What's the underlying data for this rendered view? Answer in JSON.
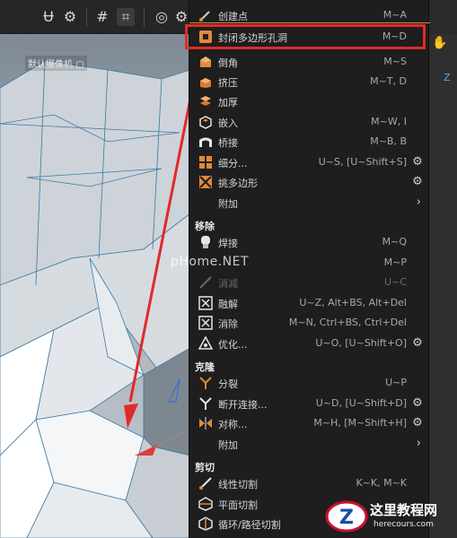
{
  "viewport": {
    "camera_label": "默认摄像机",
    "camera_icon": "camera-icon"
  },
  "watermark": {
    "text": "pHome.NET"
  },
  "logo": {
    "main": "这里教程网",
    "sub": "herecours.com"
  },
  "right_strip": {
    "axis_text": "Z"
  },
  "colors": {
    "highlight": "#e02a2a",
    "menu_bg": "#1e1e1e",
    "accent_orange": "#e08a3c"
  },
  "menu": {
    "items": [
      {
        "label": "创建点",
        "shortcut": "M~A",
        "icon": "create-point-icon"
      },
      {
        "label": "封闭多边形孔洞",
        "shortcut": "M~D",
        "icon": "close-polygon-hole-icon"
      },
      {
        "label": "倒角",
        "shortcut": "M~S",
        "icon": "bevel-icon"
      },
      {
        "label": "挤压",
        "shortcut": "M~T, D",
        "icon": "extrude-icon"
      },
      {
        "label": "加厚",
        "shortcut": "",
        "icon": "thicken-icon"
      },
      {
        "label": "嵌入",
        "shortcut": "M~W, I",
        "icon": "inset-icon"
      },
      {
        "label": "桥接",
        "shortcut": "M~B, B",
        "icon": "bridge-icon"
      },
      {
        "label": "细分...",
        "shortcut": "U~S, [U~Shift+S]",
        "icon": "subdivide-icon"
      },
      {
        "label": "挑多边形",
        "shortcut": "",
        "icon": "pick-polygon-icon"
      },
      {
        "label": "附加",
        "shortcut": "",
        "icon": ""
      }
    ],
    "section_remove": "移除",
    "remove_items": [
      {
        "label": "焊接",
        "shortcut": "M~Q",
        "icon": "weld-icon"
      },
      {
        "label": "",
        "shortcut": "M~P",
        "icon": "collapse-icon"
      },
      {
        "label": "消减",
        "shortcut": "U~C",
        "icon": "dissolve-icon"
      },
      {
        "label": "融解",
        "shortcut": "U~Z, Alt+BS, Alt+Del",
        "icon": "melt-icon"
      },
      {
        "label": "消除",
        "shortcut": "M~N, Ctrl+BS, Ctrl+Del",
        "icon": "eliminate-icon"
      },
      {
        "label": "优化...",
        "shortcut": "U~O, [U~Shift+O]",
        "icon": "optimize-icon"
      }
    ],
    "section_clone": "克隆",
    "clone_items": [
      {
        "label": "分裂",
        "shortcut": "U~P",
        "icon": "split-icon"
      },
      {
        "label": "断开连接...",
        "shortcut": "U~D, [U~Shift+D]",
        "icon": "disconnect-icon"
      },
      {
        "label": "对称...",
        "shortcut": "M~H, [M~Shift+H]",
        "icon": "symmetry-icon"
      },
      {
        "label": "附加",
        "shortcut": "",
        "icon": ""
      }
    ],
    "section_cut": "剪切",
    "cut_items": [
      {
        "label": "线性切割",
        "shortcut": "K~K, M~K",
        "icon": "line-cut-icon"
      },
      {
        "label": "平面切割",
        "shortcut": "",
        "icon": "plane-cut-icon"
      },
      {
        "label": "循环/路径切割",
        "shortcut": "",
        "icon": "loop-cut-icon"
      }
    ]
  }
}
